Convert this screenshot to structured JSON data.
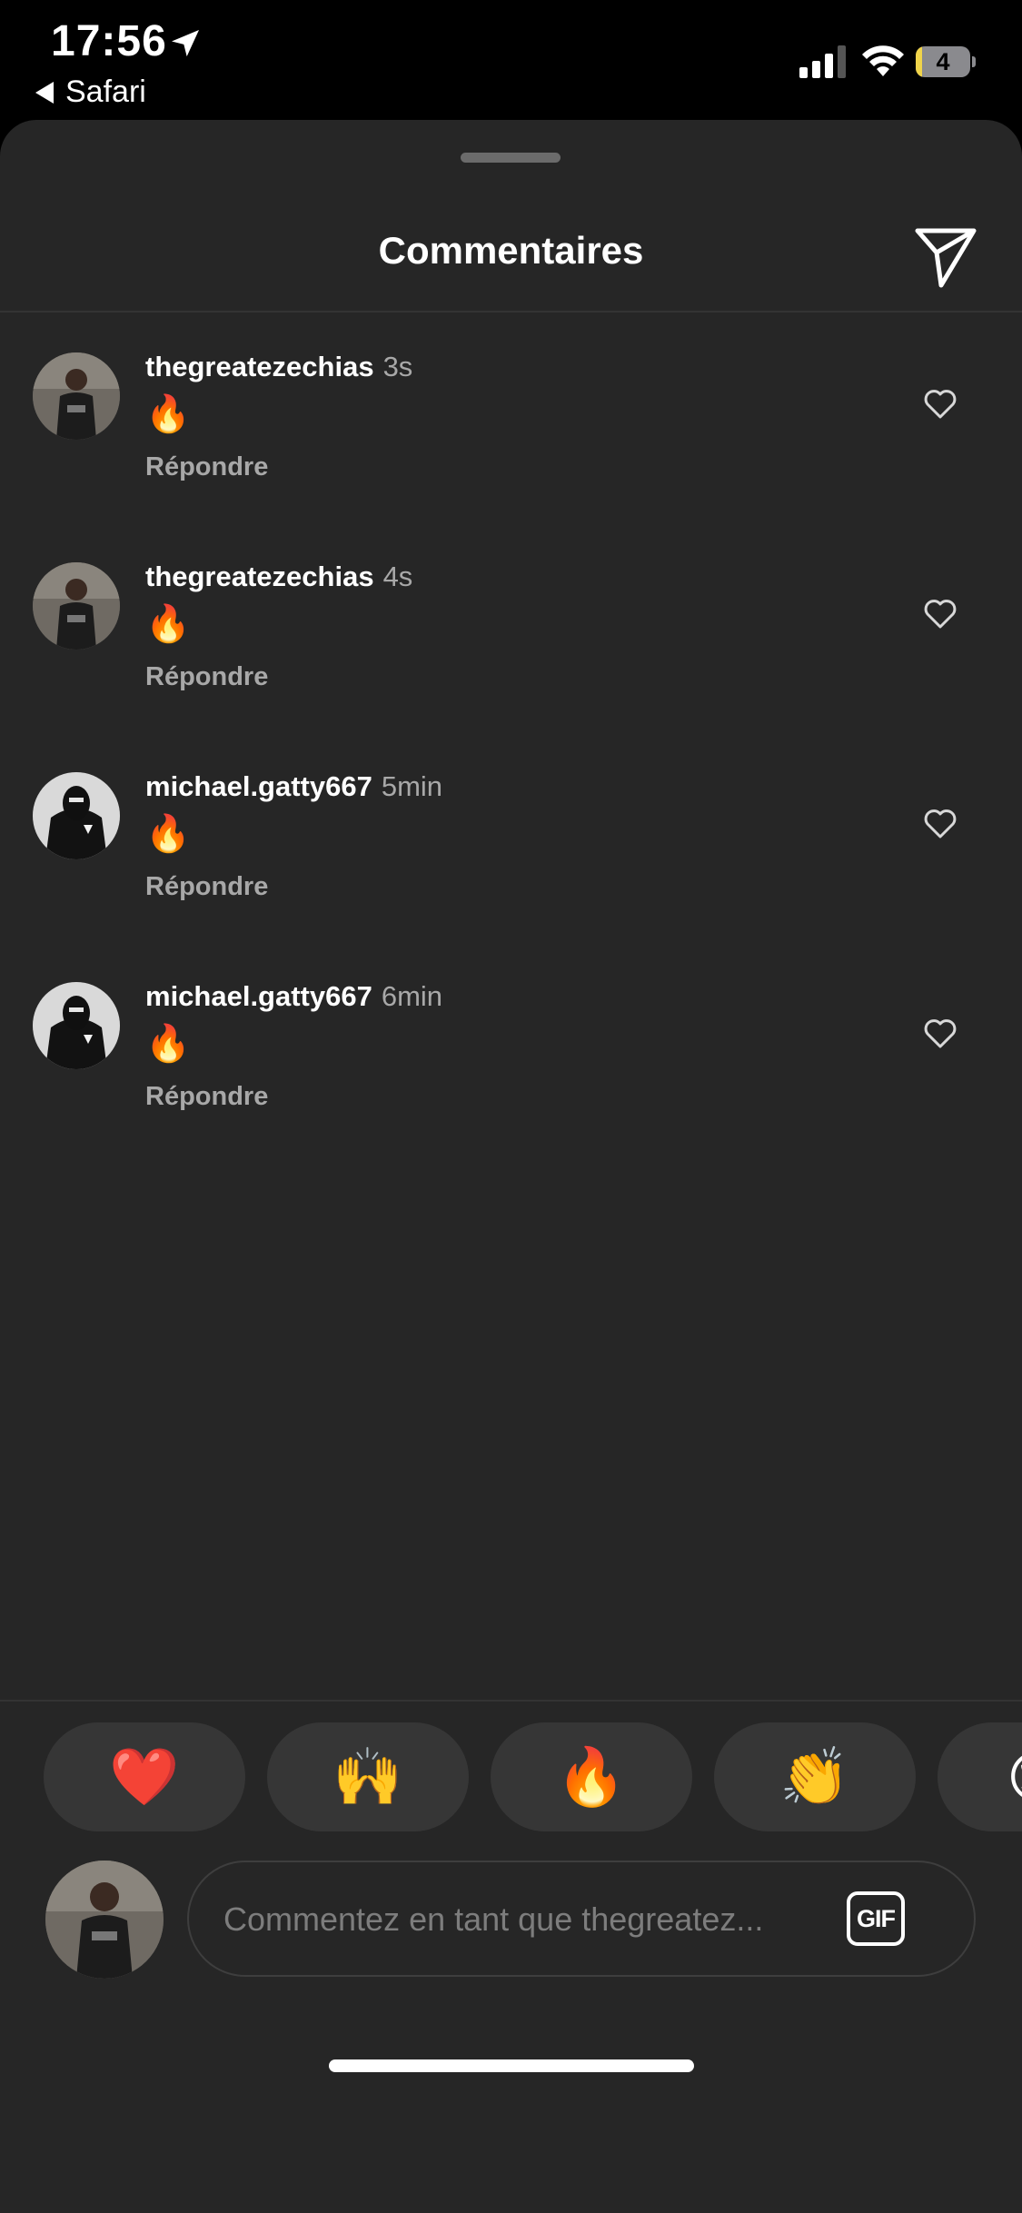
{
  "status_bar": {
    "time": "17:56",
    "back_app": "Safari",
    "battery_level": "4",
    "battery_fraction": 0.04,
    "icons": [
      "location-arrow-icon",
      "signal-bars-icon",
      "wifi-icon",
      "battery-icon"
    ]
  },
  "header": {
    "title": "Commentaires",
    "send_icon": "paper-plane-icon"
  },
  "comments": [
    {
      "username": "thegreatezechias",
      "time": "3s",
      "text": "🔥",
      "reply_label": "Répondre"
    },
    {
      "username": "thegreatezechias",
      "time": "4s",
      "text": "🔥",
      "reply_label": "Répondre"
    },
    {
      "username": "michael.gatty667",
      "time": "5min",
      "text": "🔥",
      "reply_label": "Répondre"
    },
    {
      "username": "michael.gatty667",
      "time": "6min",
      "text": "🔥",
      "reply_label": "Répondre"
    }
  ],
  "quick_reactions": [
    "❤️",
    "🙌",
    "🔥",
    "👏",
    "😢"
  ],
  "composer": {
    "placeholder": "Commentez en tant que thegreatez...",
    "gif_label": "GIF"
  },
  "colors": {
    "sheet_bg": "#262626",
    "chip_bg": "#363636",
    "muted_text": "#a8a8a8"
  }
}
